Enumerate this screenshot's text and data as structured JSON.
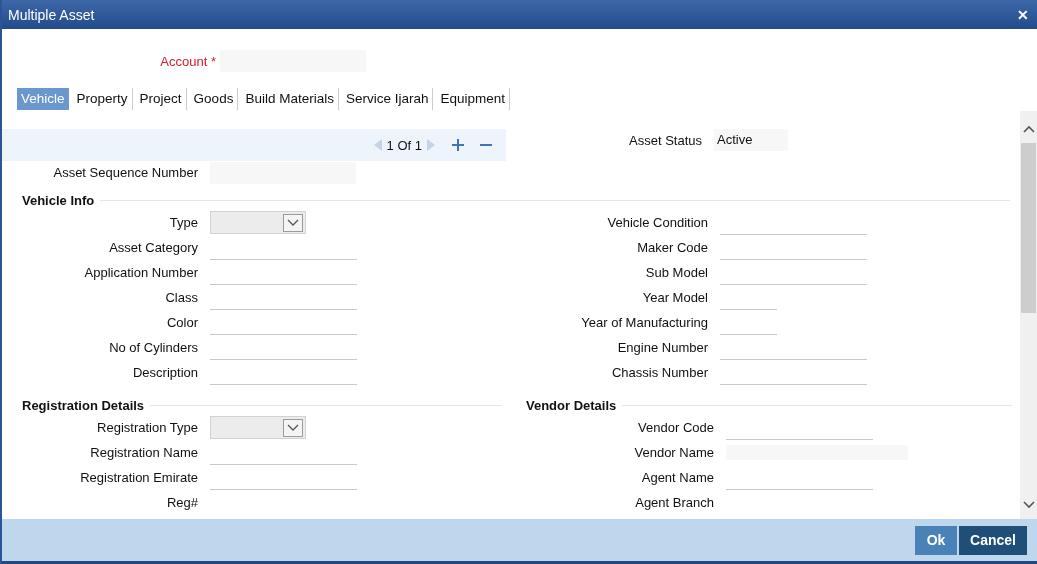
{
  "window": {
    "title": "Multiple Asset",
    "close": "✕"
  },
  "account": {
    "label": "Account *"
  },
  "tabs": [
    {
      "label": "Vehicle",
      "selected": true
    },
    {
      "label": "Property",
      "selected": false
    },
    {
      "label": "Project",
      "selected": false
    },
    {
      "label": "Goods",
      "selected": false
    },
    {
      "label": "Build Materials",
      "selected": false
    },
    {
      "label": "Service Ijarah",
      "selected": false
    },
    {
      "label": "Equipment",
      "selected": false
    }
  ],
  "pager": {
    "text": "1 Of 1"
  },
  "asset_status": {
    "label": "Asset Status",
    "value": "Active"
  },
  "asset_sequence": {
    "label": "Asset Sequence Number"
  },
  "vehicle_info": {
    "title": "Vehicle Info",
    "left": [
      {
        "label": "Type",
        "kind": "select"
      },
      {
        "label": "Asset Category",
        "kind": "text"
      },
      {
        "label": "Application Number",
        "kind": "text"
      },
      {
        "label": "Class",
        "kind": "text"
      },
      {
        "label": "Color",
        "kind": "text"
      },
      {
        "label": "No of Cylinders",
        "kind": "text"
      },
      {
        "label": "Description",
        "kind": "text"
      }
    ],
    "right": [
      {
        "label": "Vehicle Condition",
        "kind": "text"
      },
      {
        "label": "Maker Code",
        "kind": "text"
      },
      {
        "label": "Sub Model",
        "kind": "text"
      },
      {
        "label": "Year Model",
        "kind": "short"
      },
      {
        "label": "Year of Manufacturing",
        "kind": "short"
      },
      {
        "label": "Engine Number",
        "kind": "text"
      },
      {
        "label": "Chassis Number",
        "kind": "text"
      }
    ]
  },
  "registration_details": {
    "title": "Registration Details",
    "fields": [
      {
        "label": "Registration Type",
        "kind": "select"
      },
      {
        "label": "Registration Name",
        "kind": "text"
      },
      {
        "label": "Registration Emirate",
        "kind": "text"
      },
      {
        "label": "Reg#",
        "kind": "none"
      }
    ]
  },
  "vendor_details": {
    "title": "Vendor Details",
    "fields": [
      {
        "label": "Vendor Code",
        "kind": "text"
      },
      {
        "label": "Vendor Name",
        "kind": "readonly"
      },
      {
        "label": "Agent Name",
        "kind": "text"
      },
      {
        "label": "Agent Branch",
        "kind": "none"
      }
    ]
  },
  "buttons": [
    {
      "label": "Ok",
      "kind": "secondary"
    },
    {
      "label": "Cancel",
      "kind": "primary"
    }
  ]
}
